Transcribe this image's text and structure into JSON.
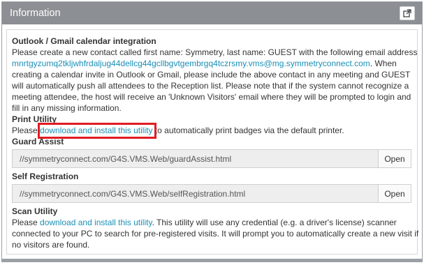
{
  "panel": {
    "title": "Information",
    "popout_icon": "external-link-icon"
  },
  "sections": {
    "outlook": {
      "title": "Outlook / Gmail calendar integration",
      "text_before": "Please create a new contact called first name: Symmetry, last name: GUEST with the following email address",
      "email": "mnrtgyzumq2tkljwhfrdaljug44dellcg44gcllbgvtgembrgq4tczrsmy.vms@mg.symmetryconnect.com",
      "text_after": ". When creating a calendar invite in Outlook or Gmail, please include the above contact in any meeting and GUEST will automatically push all attendees to the Reception list. Please note that if the system cannot recognize a meeting attendee, the host will receive an 'Unknown Visitors' email where they will be prompted to login and fill in any missing information."
    },
    "print": {
      "title": "Print Utility",
      "text_before": "Please ",
      "link": "download and install this utility",
      "text_after": " to automatically print badges via the default printer."
    },
    "guard": {
      "title": "Guard Assist",
      "url": "//symmetryconnect.com/G4S.VMS.Web/guardAssist.html",
      "open_label": "Open"
    },
    "self_reg": {
      "title": "Self Registration",
      "url": "//symmetryconnect.com/G4S.VMS.Web/selfRegistration.html",
      "open_label": "Open"
    },
    "scan": {
      "title": "Scan Utility",
      "text_before": "Please ",
      "link": "download and install this utility",
      "text_after": ". This utility will use any credential (e.g. a driver's license) scanner connected to your PC to search for pre-registered visits. It will prompt you to automatically create a new visit if no visitors are found."
    }
  },
  "colors": {
    "header_bg": "#8c8f93",
    "link": "#1a8fb6",
    "highlight": "#e11b22"
  }
}
